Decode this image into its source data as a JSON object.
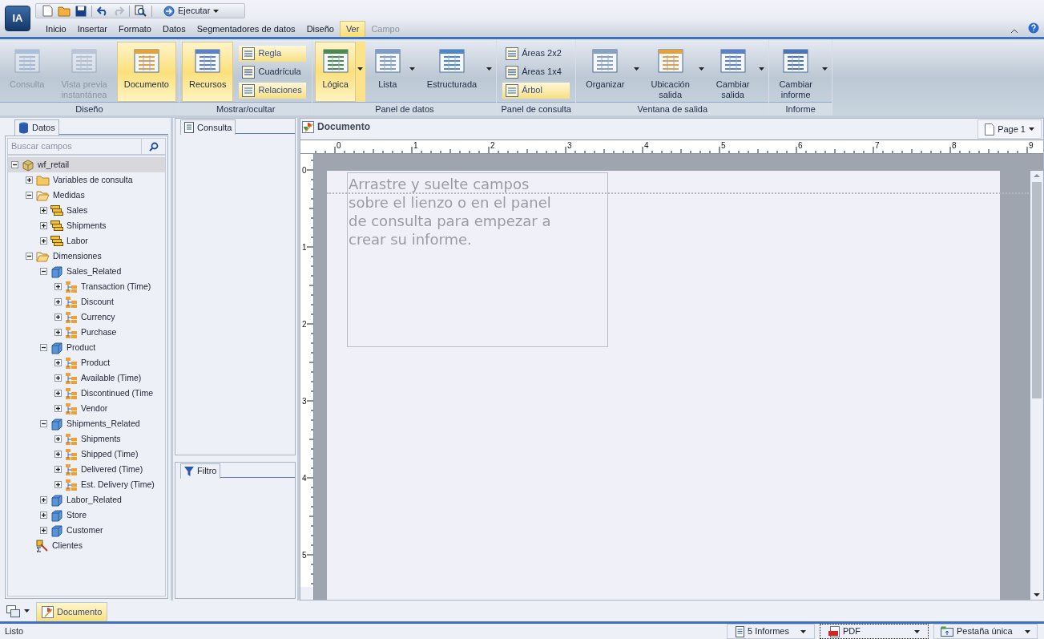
{
  "app": {
    "logo": "IA"
  },
  "quick_toolbar": {
    "run_button": "Ejecutar"
  },
  "menu_tabs": [
    {
      "label": "Inicio",
      "selected": false,
      "disabled": false
    },
    {
      "label": "Insertar",
      "selected": false,
      "disabled": false
    },
    {
      "label": "Formato",
      "selected": false,
      "disabled": false
    },
    {
      "label": "Datos",
      "selected": false,
      "disabled": false
    },
    {
      "label": "Segmentadores de datos",
      "selected": false,
      "disabled": false
    },
    {
      "label": "Diseño",
      "selected": false,
      "disabled": false
    },
    {
      "label": "Ver",
      "selected": true,
      "disabled": false
    },
    {
      "label": "Campo",
      "selected": false,
      "disabled": true
    }
  ],
  "ribbon": {
    "groups": [
      {
        "title": "Diseño",
        "items": [
          {
            "kind": "large",
            "label": "Consulta",
            "disabled": true,
            "selected": false,
            "dropdown": false
          },
          {
            "kind": "large",
            "label": "Vista previa\ninstantánea",
            "disabled": true,
            "selected": false,
            "dropdown": false
          },
          {
            "kind": "large",
            "label": "Documento",
            "disabled": false,
            "selected": true,
            "dropdown": false
          }
        ]
      },
      {
        "title": "Mostrar/ocultar",
        "items": [
          {
            "kind": "large",
            "label": "Recursos",
            "disabled": false,
            "selected": true,
            "dropdown": false
          },
          {
            "kind": "stack",
            "items": [
              {
                "label": "Regla",
                "selected": true
              },
              {
                "label": "Cuadrícula",
                "selected": false
              },
              {
                "label": "Relaciones",
                "selected": true
              }
            ]
          }
        ]
      },
      {
        "title": "Panel de datos",
        "items": [
          {
            "kind": "large",
            "label": "Lógica",
            "disabled": false,
            "selected": true,
            "dropdown": true
          },
          {
            "kind": "large",
            "label": "Lista",
            "disabled": false,
            "selected": false,
            "dropdown": true
          },
          {
            "kind": "large",
            "label": "Estructurada",
            "disabled": false,
            "selected": false,
            "dropdown": true
          }
        ]
      },
      {
        "title": "Panel de consulta",
        "items": [
          {
            "kind": "stack",
            "items": [
              {
                "label": "Áreas 2x2",
                "selected": false
              },
              {
                "label": "Áreas 1x4",
                "selected": false
              },
              {
                "label": "Árbol",
                "selected": true
              }
            ]
          }
        ]
      },
      {
        "title": "Ventana de salida",
        "items": [
          {
            "kind": "large",
            "label": "Organizar",
            "disabled": false,
            "selected": false,
            "dropdown": true
          },
          {
            "kind": "large",
            "label": "Ubicación\nsalida",
            "disabled": false,
            "selected": false,
            "dropdown": true
          },
          {
            "kind": "large",
            "label": "Cambiar\nsalida",
            "disabled": false,
            "selected": false,
            "dropdown": true
          }
        ]
      },
      {
        "title": "Informe",
        "items": [
          {
            "kind": "large",
            "label": "Cambiar\ninforme",
            "disabled": false,
            "selected": false,
            "dropdown": true
          }
        ]
      }
    ]
  },
  "data_panel": {
    "tab": "Datos",
    "search": {
      "placeholder": "Buscar campos"
    },
    "tree": [
      {
        "label": "wf_retail",
        "kind": "cube",
        "expanded": true,
        "selected": true,
        "children": [
          {
            "label": "Variables de consulta",
            "kind": "folder",
            "expanded": false,
            "selected": false
          },
          {
            "label": "Medidas",
            "kind": "folder",
            "expanded": true,
            "selected": false,
            "children": [
              {
                "label": "Sales",
                "kind": "measure",
                "expanded": false,
                "selected": false
              },
              {
                "label": "Shipments",
                "kind": "measure",
                "expanded": false,
                "selected": false
              },
              {
                "label": "Labor",
                "kind": "measure",
                "expanded": false,
                "selected": false
              }
            ]
          },
          {
            "label": "Dimensiones",
            "kind": "folder",
            "expanded": true,
            "selected": false,
            "children": [
              {
                "label": "Sales_Related",
                "kind": "dimension",
                "expanded": true,
                "selected": false,
                "children": [
                  {
                    "label": "Transaction (Time)",
                    "kind": "hierarchy",
                    "expanded": false,
                    "selected": false
                  },
                  {
                    "label": "Discount",
                    "kind": "hierarchy",
                    "expanded": false,
                    "selected": false
                  },
                  {
                    "label": "Currency",
                    "kind": "hierarchy",
                    "expanded": false,
                    "selected": false
                  },
                  {
                    "label": "Purchase",
                    "kind": "hierarchy",
                    "expanded": false,
                    "selected": false
                  }
                ]
              },
              {
                "label": "Product",
                "kind": "dimension",
                "expanded": true,
                "selected": false,
                "children": [
                  {
                    "label": "Product",
                    "kind": "hierarchy",
                    "expanded": false,
                    "selected": false
                  },
                  {
                    "label": "Available (Time)",
                    "kind": "hierarchy",
                    "expanded": false,
                    "selected": false
                  },
                  {
                    "label": "Discontinued (Time",
                    "kind": "hierarchy",
                    "expanded": false,
                    "selected": false
                  },
                  {
                    "label": "Vendor",
                    "kind": "hierarchy",
                    "expanded": false,
                    "selected": false
                  }
                ]
              },
              {
                "label": "Shipments_Related",
                "kind": "dimension",
                "expanded": true,
                "selected": false,
                "children": [
                  {
                    "label": "Shipments",
                    "kind": "hierarchy",
                    "expanded": false,
                    "selected": false
                  },
                  {
                    "label": "Shipped (Time)",
                    "kind": "hierarchy",
                    "expanded": false,
                    "selected": false
                  },
                  {
                    "label": "Delivered (Time)",
                    "kind": "hierarchy",
                    "expanded": false,
                    "selected": false
                  },
                  {
                    "label": "Est. Delivery (Time)",
                    "kind": "hierarchy",
                    "expanded": false,
                    "selected": false
                  }
                ]
              },
              {
                "label": "Labor_Related",
                "kind": "dimension",
                "expanded": false,
                "selected": false
              },
              {
                "label": "Store",
                "kind": "dimension",
                "expanded": false,
                "selected": false
              },
              {
                "label": "Customer",
                "kind": "dimension",
                "expanded": false,
                "selected": false
              }
            ]
          },
          {
            "label": "Clientes",
            "kind": "filter",
            "selected": false
          }
        ]
      }
    ]
  },
  "query_panel": {
    "tab": "Consulta"
  },
  "filter_panel": {
    "tab": "Filtro"
  },
  "document": {
    "title": "Documento",
    "page_button": "Page 1",
    "ruler": {
      "horizontal": [
        "0",
        "1",
        "2",
        "3",
        "4",
        "5",
        "6",
        "7",
        "8",
        "9"
      ],
      "vertical": [
        "0",
        "1",
        "2",
        "3",
        "4",
        "5"
      ]
    },
    "placeholder": "Arrastre y suelte campos sobre el lienzo o en el panel de consulta para empezar a crear su informe."
  },
  "bottom_tabs": [
    {
      "label": "Documento",
      "selected": true
    }
  ],
  "status_bar": {
    "text": "Listo",
    "reports": "5 Informes",
    "format": "PDF",
    "output": "Pestaña única"
  }
}
